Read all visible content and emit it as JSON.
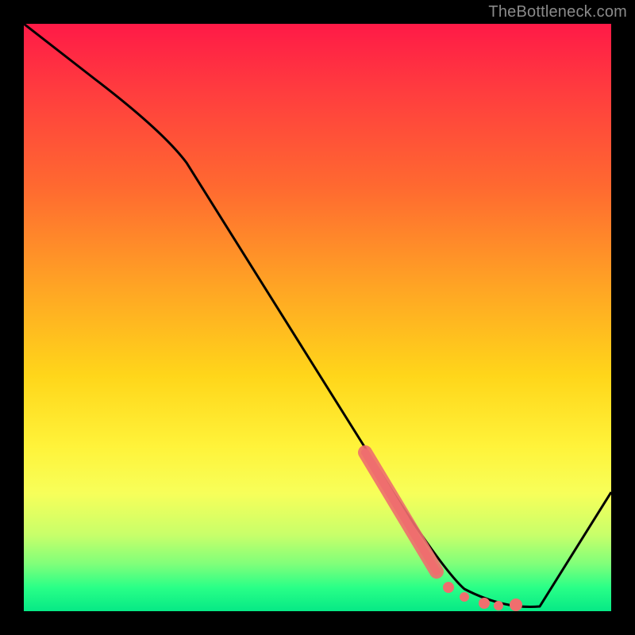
{
  "watermark": "TheBottleneck.com",
  "chart_data": {
    "type": "line",
    "title": "",
    "xlabel": "",
    "ylabel": "",
    "xlim": [
      0,
      100
    ],
    "ylim": [
      0,
      100
    ],
    "grid": false,
    "legend": false,
    "x": [
      0,
      10,
      20,
      30,
      40,
      50,
      60,
      68,
      74,
      80,
      86,
      100
    ],
    "y": [
      100,
      92,
      82,
      70,
      56,
      42,
      28,
      15,
      6,
      1,
      1,
      22
    ],
    "annotations": {
      "comment": "bottleneck corridor markers near the minimum of the curve",
      "corridor_band": {
        "x_range": [
          58,
          68
        ],
        "color": "#ef6e6e"
      },
      "dots": {
        "x": [
          69,
          71,
          73,
          75,
          77
        ],
        "color": "#ef6e6e"
      }
    },
    "colors": {
      "curve": "#000000",
      "background_top": "#ff1a47",
      "background_mid": "#ffd61a",
      "background_bottom": "#06e986",
      "frame": "#000000"
    }
  }
}
